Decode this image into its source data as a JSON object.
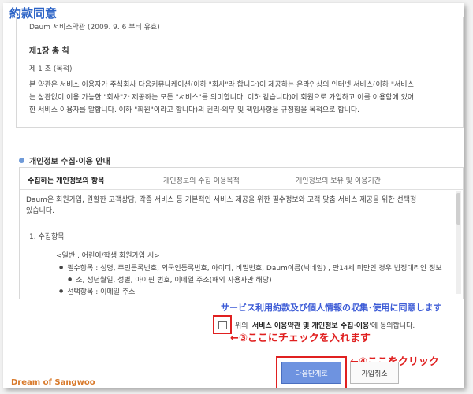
{
  "header": {
    "title": "約款同意"
  },
  "terms": {
    "meta": "Daum 서비스약관 (2009. 9. 6 부터 유효)",
    "chapter": "제1장 총 칙",
    "article": "제 1 조 (목적)",
    "body_lines": [
      "본 약관은 서비스 이용자가 주식회사 다음커뮤니케이션(이하 \"회사\"라 합니다)이 제공하는 온라인상의 인터넷 서비스(이하 \"서비스",
      "는 상관없이 이용 가능한 \"회사\"가 제공하는 모든 \"서비스\"를 의미합니다. 이하 같습니다)에 회원으로 가입하고 이를 이용함에 있어",
      "한 서비스 이용자를 말합니다. 이하 \"회원\"이라고 합니다)의 권리·의무 및 책임사항을 규정함을 목적으로 합니다."
    ]
  },
  "privacy": {
    "section_title": "개인정보 수집·이용 안내",
    "tabs": [
      {
        "label": "수집하는 개인정보의 항목"
      },
      {
        "label": "개인정보의 수집 이용목적"
      },
      {
        "label": "개인정보의 보유 및 이용기간"
      }
    ],
    "body_lines": [
      "Daum은 회원가입, 원활한 고객상담, 각종 서비스 등 기본적인 서비스 제공을 위한 필수정보와 고객 맞춤 서비스 제공을 위한 선택정",
      "있습니다."
    ],
    "list_head": "1.    수집항목",
    "sub_head": "<일반 , 어린이/학생 회원가입 시>",
    "bullet1": "필수항목 : 성명, 주민등록번호, 외국인등록번호, 아이디, 비밀번호, Daum이름(닉네임) , 만14세 미만인 경우 법정대리인 정보",
    "bullet1_cont": "소, 생년월일, 성별, 아이핀 번호, 이메일 주소(해외 사용자만 해당)",
    "bullet2": "선택항목 : 이메일 주소"
  },
  "annotations": {
    "blue": "サービス利用約款及び個人情報の収集･使用に同意します",
    "step3": "←③ここにチェックを入れます",
    "step4": "←④ここをクリック"
  },
  "agree": {
    "prefix": "위의 '",
    "bold": "서비스 이용약관 및 개인정보 수집·이용",
    "suffix": "'에 동의합니다."
  },
  "buttons": {
    "next": "다음단계로",
    "cancel": "가입취소"
  },
  "watermark": "Dream of Sangwoo",
  "colors": {
    "title_blue": "#2b63c6",
    "annotation_red": "#e02020",
    "annotation_blue": "#3c5bd6",
    "button_blue": "#6e93e0"
  }
}
